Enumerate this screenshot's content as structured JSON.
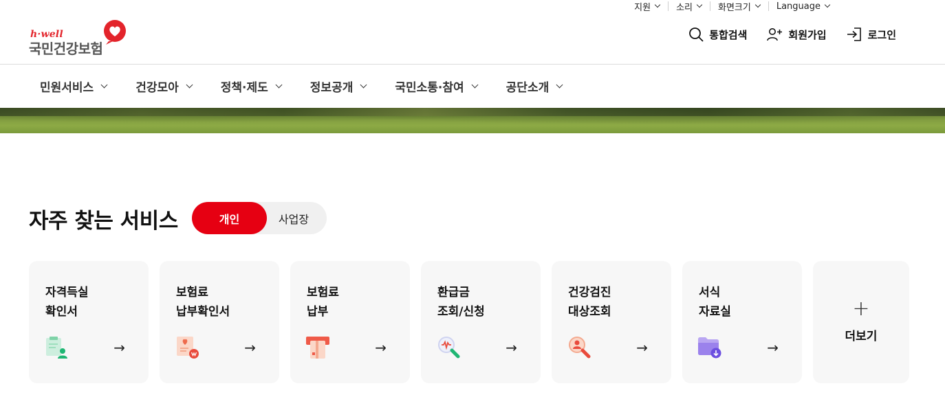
{
  "utility": [
    {
      "label": "지원"
    },
    {
      "label": "소리"
    },
    {
      "label": "화면크기"
    },
    {
      "label": "Language"
    }
  ],
  "logo": {
    "sub": "h·well",
    "main": "국민건강보험"
  },
  "actions": {
    "search": {
      "label": "통합검색",
      "icon": "search-icon"
    },
    "signup": {
      "label": "회원가입",
      "icon": "user-plus-icon"
    },
    "login": {
      "label": "로그인",
      "icon": "login-icon"
    }
  },
  "nav": [
    {
      "label": "민원서비스"
    },
    {
      "label": "건강모아"
    },
    {
      "label": "정책·제도"
    },
    {
      "label": "정보공개"
    },
    {
      "label": "국민소통·참여"
    },
    {
      "label": "공단소개"
    }
  ],
  "services": {
    "title": "자주 찾는 서비스",
    "toggle": {
      "active": "개인",
      "inactive": "사업장"
    },
    "cards": [
      {
        "line1": "자격득실",
        "line2": "확인서",
        "icon": "certificate-icon"
      },
      {
        "line1": "보험료",
        "line2": "납부확인서",
        "icon": "payment-receipt-icon"
      },
      {
        "line1": "보험료",
        "line2": "납부",
        "icon": "card-payment-icon"
      },
      {
        "line1": "환급금",
        "line2": "조회/신청",
        "icon": "refund-search-icon"
      },
      {
        "line1": "건강검진",
        "line2": "대상조회",
        "icon": "checkup-search-icon"
      },
      {
        "line1": "서식",
        "line2": "자료실",
        "icon": "folder-download-icon"
      }
    ],
    "arrow": "→",
    "more": {
      "plus": "+",
      "label": "더보기"
    }
  },
  "colors": {
    "brand_red": "#e60012",
    "card_bg": "#f7f7f7",
    "toggle_bg": "#f0f0f0"
  }
}
